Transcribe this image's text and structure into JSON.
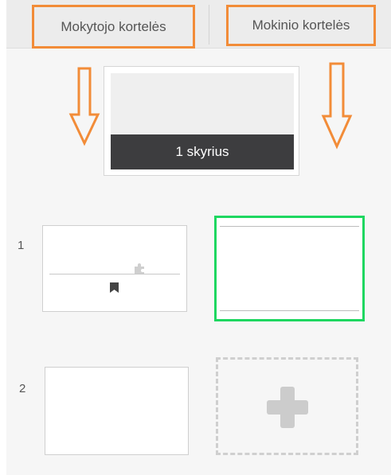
{
  "tabs": {
    "teacher_label": "Mokytojo kortelės",
    "student_label": "Mokinio kortelės"
  },
  "chapter": {
    "label": "1 skyrius"
  },
  "rows": [
    {
      "number": "1"
    },
    {
      "number": "2"
    }
  ],
  "colors": {
    "highlight_orange": "#f28c38",
    "selected_green": "#1ed760",
    "chapter_label_bg": "#3d3d3f"
  },
  "icons": {
    "bookmark": "bookmark-icon",
    "puzzle": "puzzle-icon",
    "add": "plus-icon",
    "arrow_down": "arrow-down-icon"
  }
}
